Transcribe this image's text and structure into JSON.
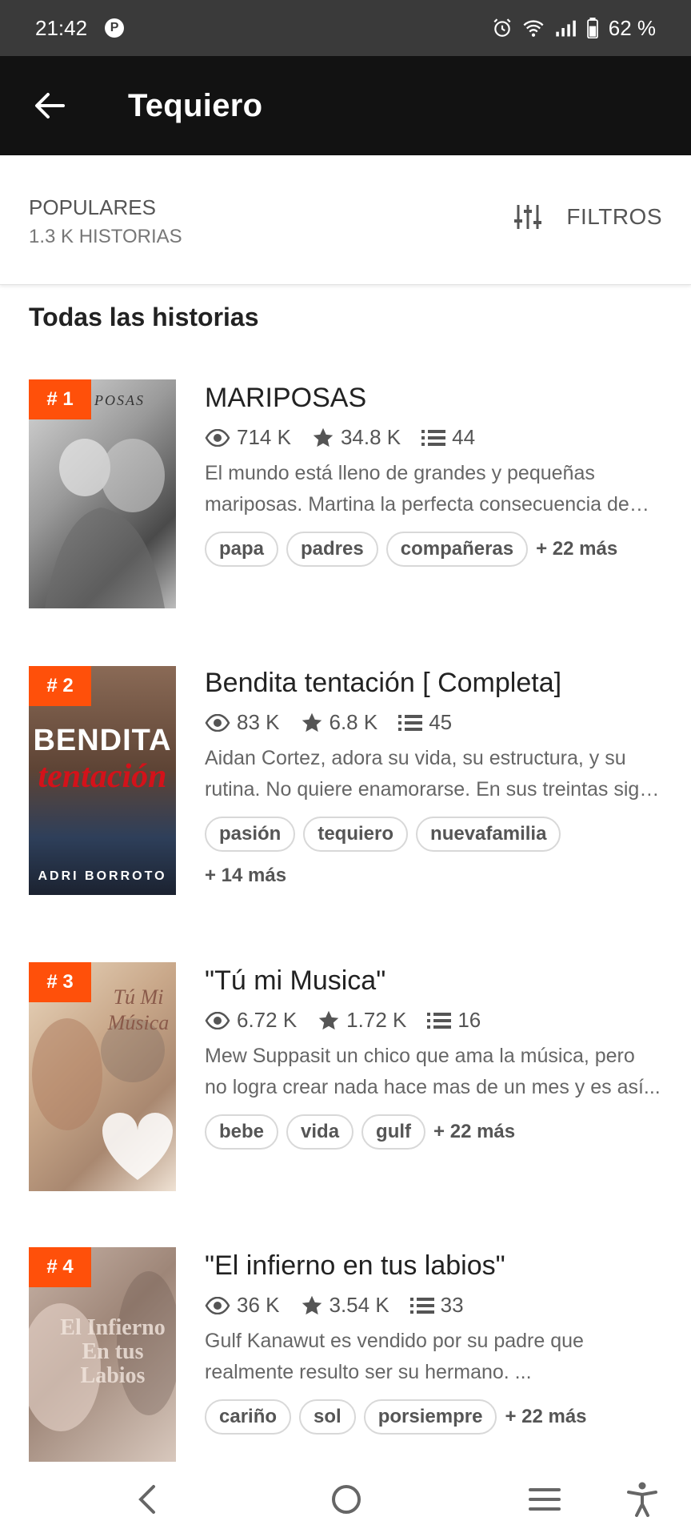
{
  "status_bar": {
    "time": "21:42",
    "battery": "62 %"
  },
  "app_bar": {
    "title": "Tequiero"
  },
  "sort": {
    "label": "POPULARES",
    "count": "1.3 K HISTORIAS",
    "filters_label": "FILTROS"
  },
  "section_title": "Todas las historias",
  "stories": [
    {
      "rank": "# 1",
      "title": "MARIPOSAS",
      "reads": "714 K",
      "votes": "34.8 K",
      "parts": "44",
      "description": "El mundo está lleno de grandes y pequeñas mariposas. Martina la perfecta consecuencia de esta historia...",
      "tags": [
        "papa",
        "padres",
        "compañeras"
      ],
      "more": "+ 22 más",
      "cover_text": "POSAS"
    },
    {
      "rank": "# 2",
      "title": "Bendita tentación [ Completa]",
      "reads": "83 K",
      "votes": "6.8 K",
      "parts": "45",
      "description": "Aidan Cortez, adora su vida, su estructura, y su rutina. No quiere enamorarse. En sus treintas sigue soltero...",
      "tags": [
        "pasión",
        "tequiero",
        "nuevafamilia"
      ],
      "more": "+ 14 más",
      "cover_title": "BENDITA",
      "cover_subtitle": "tentación",
      "cover_author": "ADRI BORROTO"
    },
    {
      "rank": "# 3",
      "title": "\"Tú mi Musica\"",
      "reads": "6.72 K",
      "votes": "1.72 K",
      "parts": "16",
      "description": "Mew Suppasit un chico que ama la música, pero no logra crear nada hace mas de un mes y es así...",
      "tags": [
        "bebe",
        "vida",
        "gulf"
      ],
      "more": "+ 22 más",
      "cover_text": "Tú Mi Música"
    },
    {
      "rank": "# 4",
      "title": "\"El infierno en tus labios\"",
      "reads": "36 K",
      "votes": "3.54 K",
      "parts": "33",
      "description": "Gulf Kanawut es vendido por su padre que realmente resulto ser su hermano. ...",
      "tags": [
        "cariño",
        "sol",
        "porsiempre"
      ],
      "more": "+ 22 más",
      "cover_text": "El Infierno En tus Labios"
    }
  ]
}
